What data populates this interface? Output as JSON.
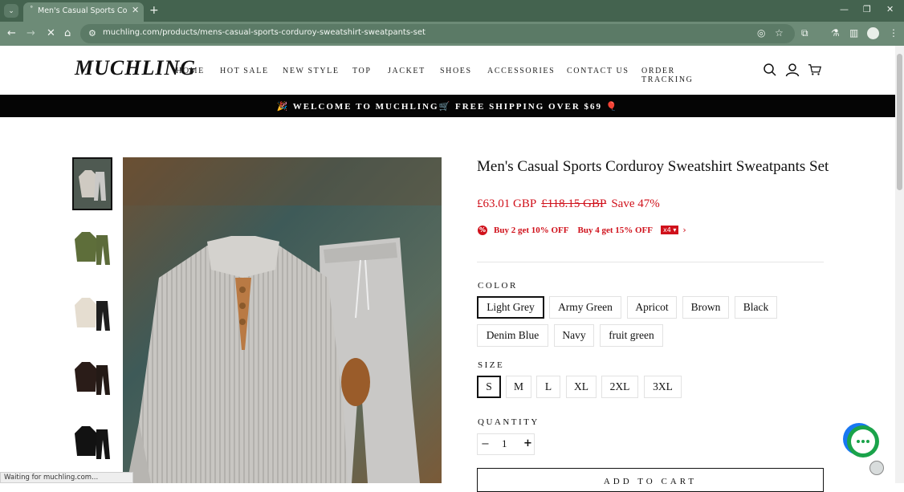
{
  "browser": {
    "tab_title": "Men's Casual Sports Corduroy",
    "new_tab_symbol": "+",
    "tab_close_symbol": "✕",
    "url": "muchling.com/products/mens-casual-sports-corduroy-sweatshirt-sweatpants-set",
    "status_text": "Waiting for muchling.com...",
    "colors": {
      "frame": "#44634f",
      "toolbar": "#6d8b77"
    }
  },
  "site": {
    "logo": "MUCHLING",
    "nav": [
      "HOME",
      "HOT SALE",
      "NEW STYLE",
      "TOP",
      "JACKET",
      "SHOES",
      "ACCESSORIES",
      "CONTACT US",
      "ORDER TRACKING"
    ],
    "icons": [
      "search-icon",
      "account-icon",
      "cart-icon"
    ],
    "announcement": "🎉 WELCOME TO MUCHLING🛒 FREE SHIPPING OVER $69 🎈"
  },
  "product": {
    "title": "Men's Casual Sports Corduroy Sweatshirt Sweatpants Set",
    "price": "£63.01 GBP",
    "compare_price": "£118.15 GBP",
    "save": "Save 47%",
    "promo_1": "Buy 2 get 10% OFF",
    "promo_2": "Buy 4 get 15% OFF",
    "promo_badge": "x4 ▾",
    "color_label": "COLOR",
    "colors": [
      "Light Grey",
      "Army Green",
      "Apricot",
      "Brown",
      "Black",
      "Denim Blue",
      "Navy",
      "fruit green"
    ],
    "selected_color": "Light Grey",
    "size_label": "SIZE",
    "sizes": [
      "S",
      "M",
      "L",
      "XL",
      "2XL",
      "3XL"
    ],
    "selected_size": "S",
    "quantity_label": "QUANTITY",
    "quantity": "1",
    "qty_minus": "−",
    "qty_plus": "+",
    "add_to_cart": "ADD TO CART",
    "thumbnails": [
      "light-grey",
      "army-green",
      "apricot",
      "brown",
      "black"
    ],
    "accent_color": "#d0111b"
  }
}
